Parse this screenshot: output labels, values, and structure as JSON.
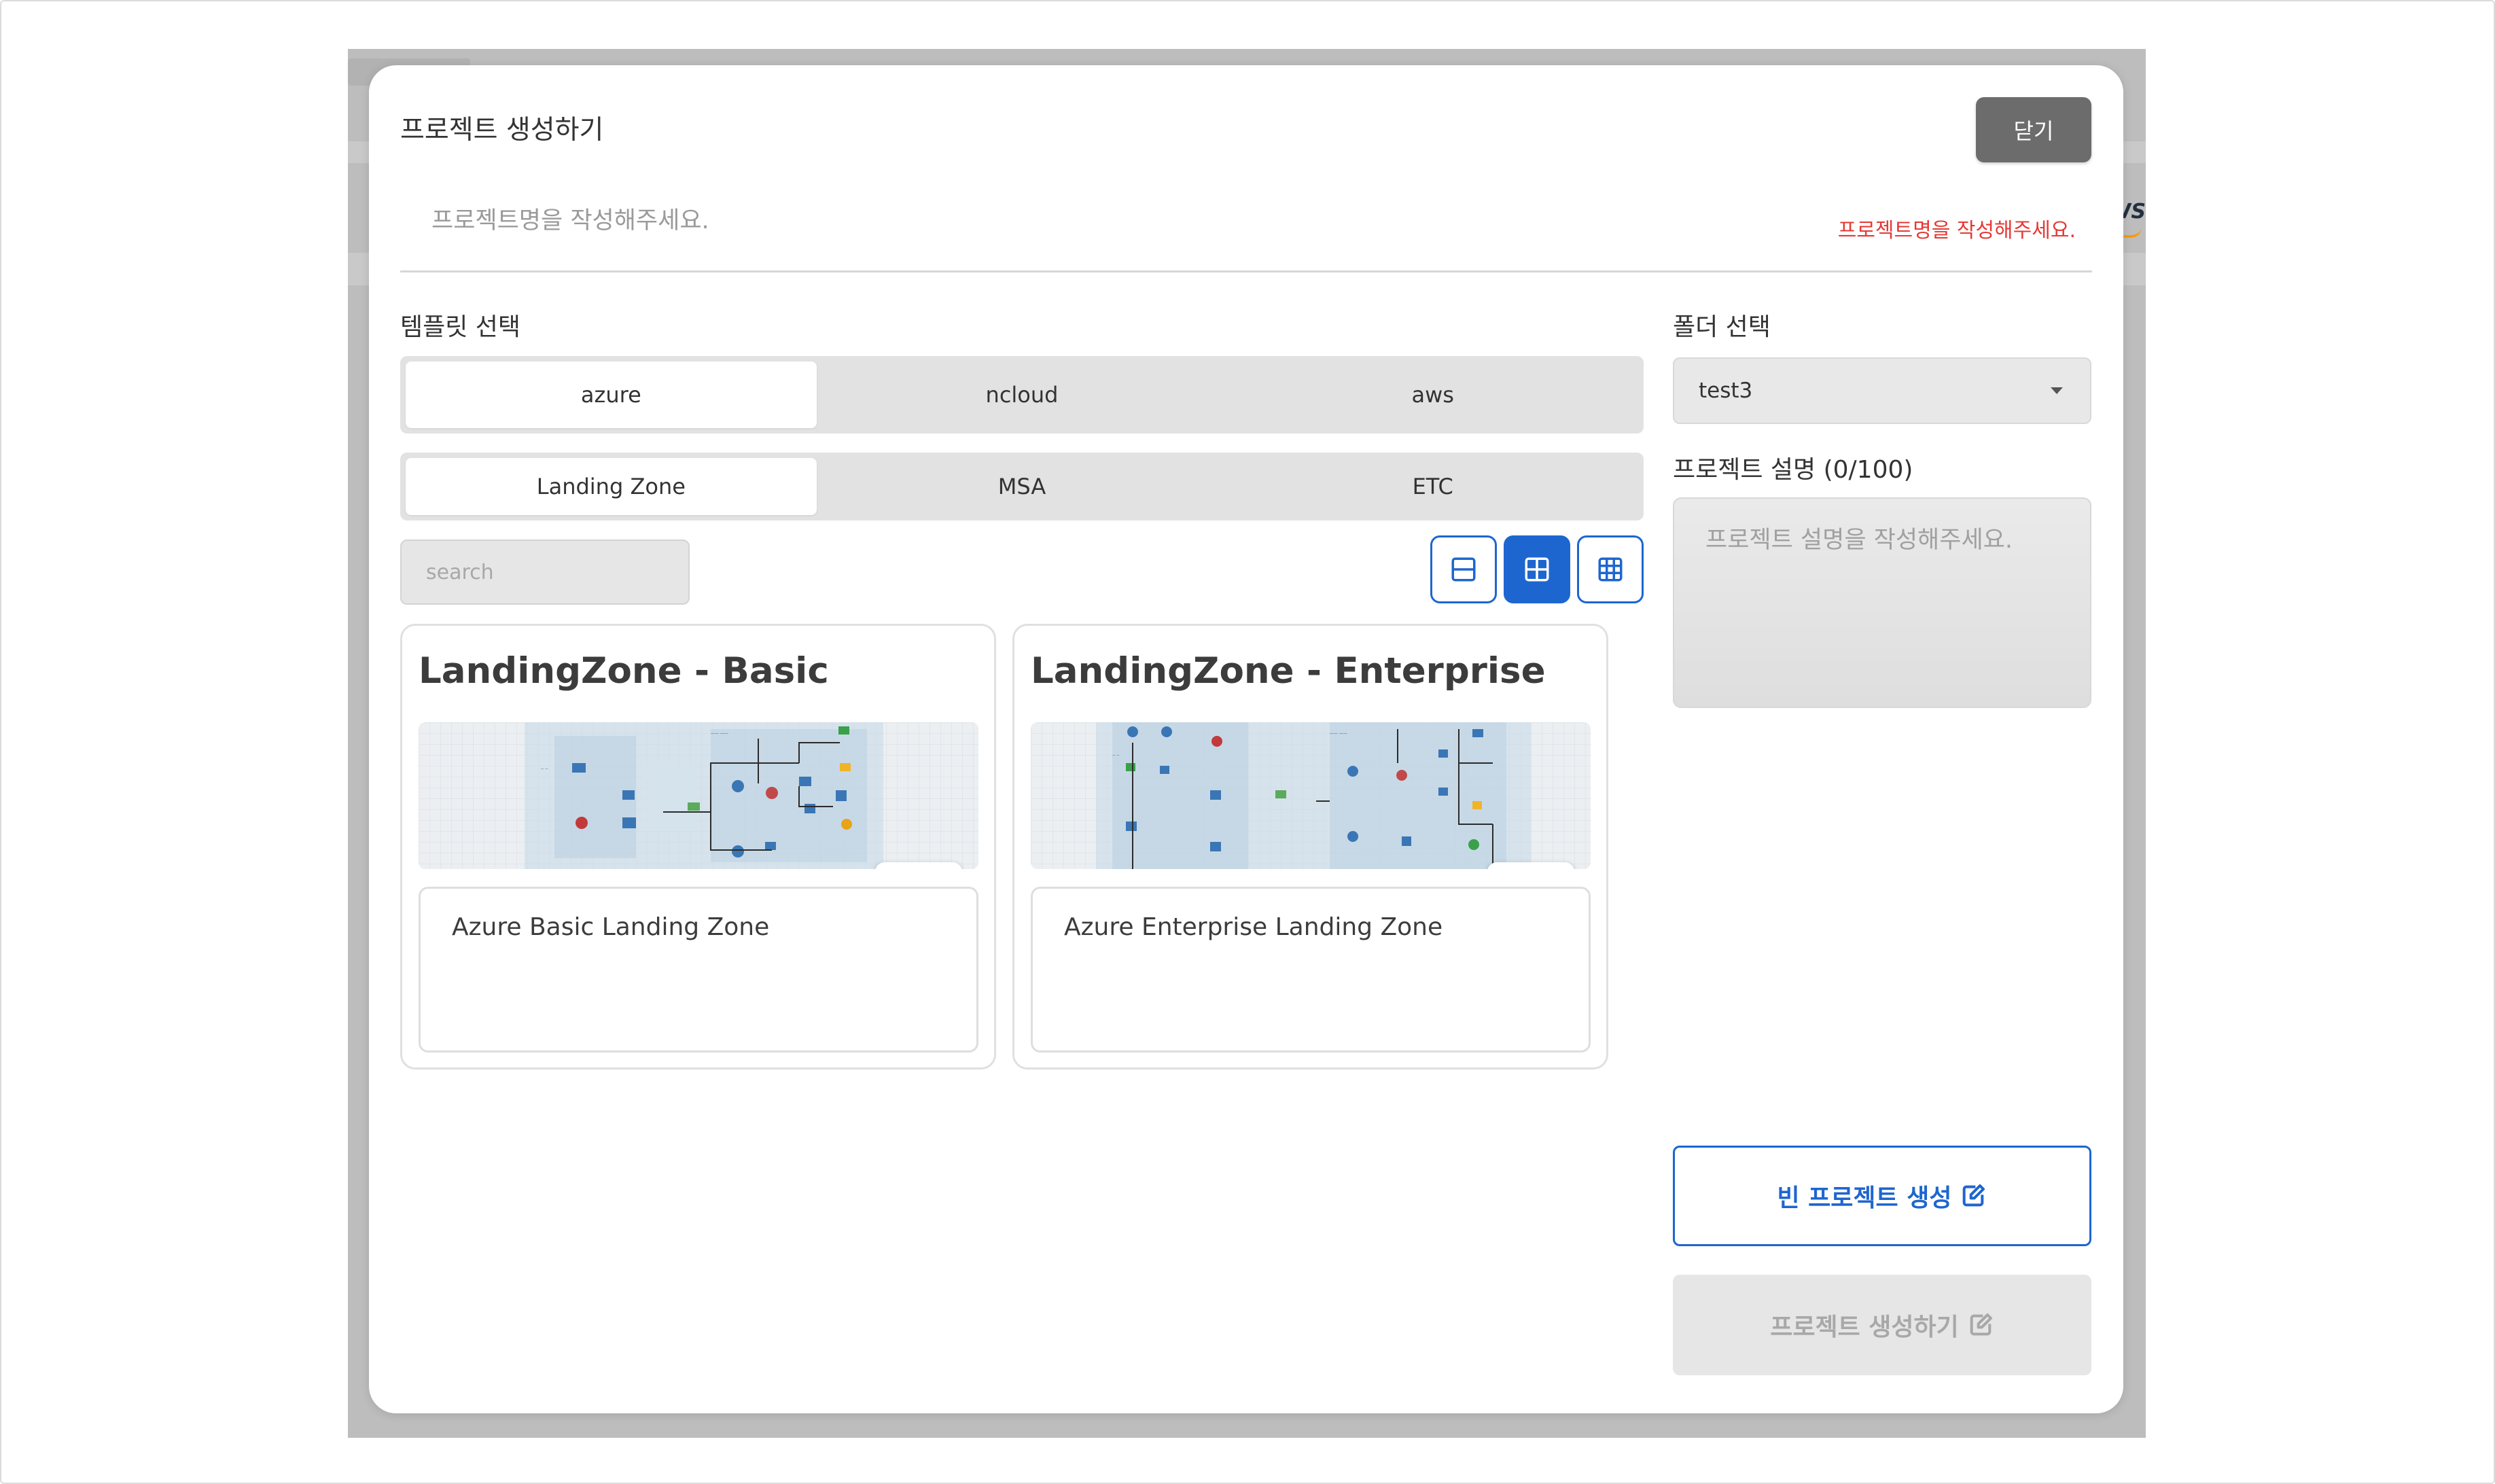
{
  "modal": {
    "title": "프로젝트 생성하기",
    "close_label": "닫기",
    "name_placeholder": "프로젝트명을 작성해주세요.",
    "name_error": "프로젝트명을 작성해주세요."
  },
  "template": {
    "label": "템플릿 선택",
    "providers": [
      {
        "label": "azure",
        "active": true
      },
      {
        "label": "ncloud",
        "active": false
      },
      {
        "label": "aws",
        "active": false
      }
    ],
    "categories": [
      {
        "label": "Landing Zone",
        "active": true
      },
      {
        "label": "MSA",
        "active": false
      },
      {
        "label": "ETC",
        "active": false
      }
    ],
    "search_placeholder": "search",
    "view_modes": [
      "list-view-icon",
      "grid-2-view-icon",
      "grid-3-view-icon"
    ],
    "active_view": "grid-2-view-icon",
    "cards": [
      {
        "title": "LandingZone - Basic",
        "description": "Azure Basic Landing Zone"
      },
      {
        "title": "LandingZone - Enterprise",
        "description": "Azure Enterprise Landing Zone"
      }
    ]
  },
  "folder": {
    "label": "폴더 선택",
    "selected": "test3"
  },
  "description": {
    "label": "프로젝트 설명 (0/100)",
    "placeholder": "프로젝트 설명을 작성해주세요."
  },
  "actions": {
    "blank_project_label": "빈 프로젝트 생성",
    "create_project_label": "프로젝트 생성하기"
  },
  "colors": {
    "accent": "#1e66cf",
    "error": "#e53935",
    "close_button": "#6c6c6c"
  }
}
